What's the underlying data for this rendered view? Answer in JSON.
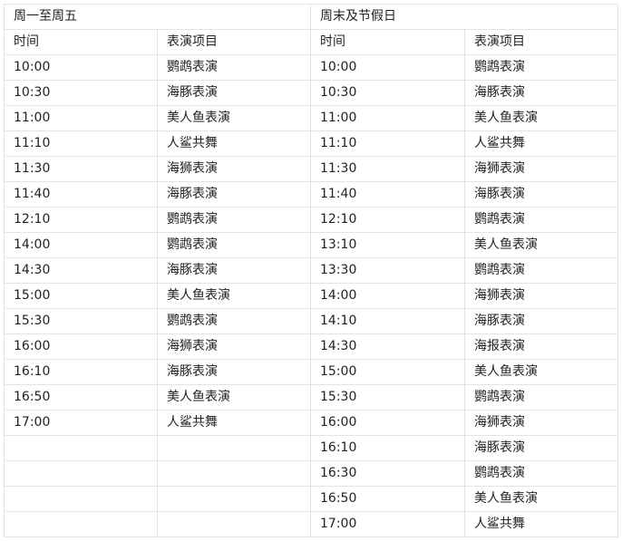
{
  "weekday": {
    "title": "周一至周五",
    "header": {
      "time": "时间",
      "show": "表演项目"
    },
    "rows": [
      [
        "10:00",
        "鹦鹉表演"
      ],
      [
        "10:30",
        "海豚表演"
      ],
      [
        "11:00",
        "美人鱼表演"
      ],
      [
        "11:10",
        "人鲨共舞"
      ],
      [
        "11:30",
        "海狮表演"
      ],
      [
        "11:40",
        "海豚表演"
      ],
      [
        "12:10",
        "鹦鹉表演"
      ],
      [
        "14:00",
        "鹦鹉表演"
      ],
      [
        "14:30",
        "海豚表演"
      ],
      [
        "15:00",
        "美人鱼表演"
      ],
      [
        "15:30",
        "鹦鹉表演"
      ],
      [
        "16:00",
        "海狮表演"
      ],
      [
        "16:10",
        "海豚表演"
      ],
      [
        "16:50",
        "美人鱼表演"
      ],
      [
        "17:00",
        "人鲨共舞"
      ]
    ]
  },
  "weekend": {
    "title": "周末及节假日",
    "header": {
      "time": "时间",
      "show": "表演项目"
    },
    "rows": [
      [
        "10:00",
        "鹦鹉表演"
      ],
      [
        "10:30",
        "海豚表演"
      ],
      [
        "11:00",
        "美人鱼表演"
      ],
      [
        "11:10",
        "人鲨共舞"
      ],
      [
        "11:30",
        "海狮表演"
      ],
      [
        "11:40",
        "海豚表演"
      ],
      [
        "12:10",
        "鹦鹉表演"
      ],
      [
        "13:10",
        "美人鱼表演"
      ],
      [
        "13:30",
        "鹦鹉表演"
      ],
      [
        "14:00",
        "海狮表演"
      ],
      [
        "14:10",
        "海豚表演"
      ],
      [
        "14:30",
        "海报表演"
      ],
      [
        "15:00",
        "美人鱼表演"
      ],
      [
        "15:30",
        "鹦鹉表演"
      ],
      [
        "16:00",
        "海狮表演"
      ],
      [
        "16:10",
        "海豚表演"
      ],
      [
        "16:30",
        "鹦鹉表演"
      ],
      [
        "16:50",
        "美人鱼表演"
      ],
      [
        "17:00",
        "人鲨共舞"
      ]
    ]
  }
}
